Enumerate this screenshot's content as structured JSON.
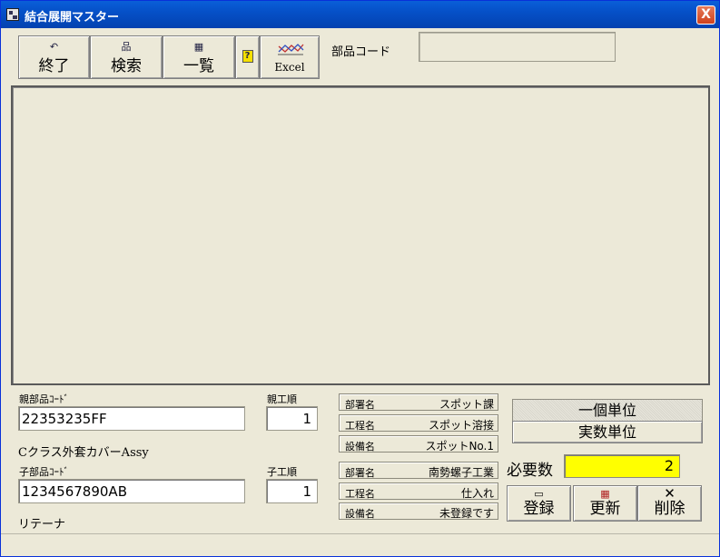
{
  "window": {
    "title": "結合展開マスター",
    "close_label": "X"
  },
  "toolbar": {
    "buttons": [
      {
        "label": "終了",
        "icon": "undo-icon",
        "glyph": "↶"
      },
      {
        "label": "検索",
        "icon": "tree-icon",
        "glyph": "品"
      },
      {
        "label": "一覧",
        "icon": "grid-icon",
        "glyph": "▦"
      },
      {
        "label": "",
        "icon": "help-icon",
        "glyph": "?"
      },
      {
        "label": "Excel",
        "icon": "chart-icon",
        "glyph": ""
      }
    ]
  },
  "part_code": {
    "label": "部品コード",
    "value": ""
  },
  "parent": {
    "code_label": "親部品ｺｰﾄﾞ",
    "code_value": "22353235FF",
    "order_label": "親工順",
    "order_value": "1",
    "name": "Cクラス外套カバーAssy"
  },
  "child": {
    "code_label": "子部品ｺｰﾄﾞ",
    "code_value": "1234567890AB",
    "order_label": "子工順",
    "order_value": "1",
    "name": "リテーナ"
  },
  "parent_info": [
    {
      "key": "部署名",
      "value": "スポット課"
    },
    {
      "key": "工程名",
      "value": "スポット溶接"
    },
    {
      "key": "設備名",
      "value": "スポットNo.1"
    }
  ],
  "child_info": [
    {
      "key": "部署名",
      "value": "南勢螺子工業"
    },
    {
      "key": "工程名",
      "value": "仕入れ"
    },
    {
      "key": "設備名",
      "value": "未登録です"
    }
  ],
  "units": {
    "single": "一個単位",
    "actual": "実数単位",
    "selected": "single"
  },
  "required": {
    "label": "必要数",
    "value": "2"
  },
  "actions": {
    "register": "登録",
    "update": "更新",
    "delete": "削除"
  },
  "colors": {
    "title_bar": "#0550c8",
    "required_bg": "#ffff00",
    "window_bg": "#ece9d8"
  }
}
